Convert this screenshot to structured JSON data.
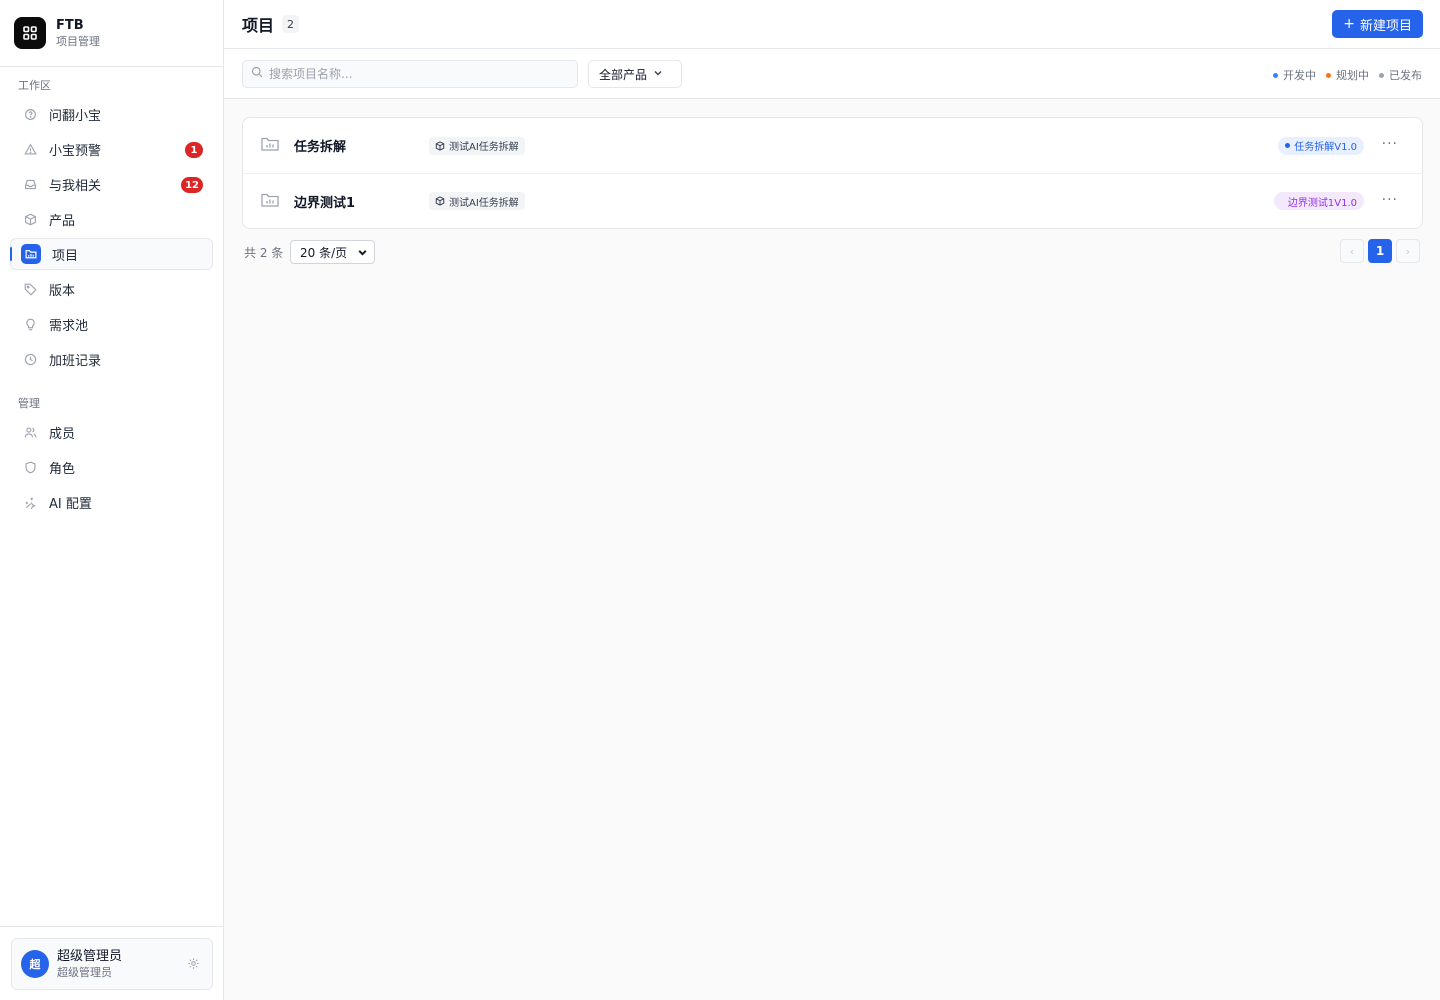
{
  "brand": {
    "title": "FTB",
    "subtitle": "项目管理",
    "icon": "grid-icon"
  },
  "sidebar": {
    "sections": [
      {
        "label": "工作区",
        "items": [
          {
            "label": "问翻小宝",
            "icon": "chat-bubble-icon"
          },
          {
            "label": "小宝预警",
            "icon": "warning-triangle-icon",
            "badge": "1"
          },
          {
            "label": "与我相关",
            "icon": "inbox-icon",
            "badge": "12"
          },
          {
            "label": "产品",
            "icon": "box-icon"
          },
          {
            "label": "项目",
            "icon": "folder-icon",
            "active": true
          },
          {
            "label": "版本",
            "icon": "tag-icon"
          },
          {
            "label": "需求池",
            "icon": "lightbulb-icon"
          },
          {
            "label": "加班记录",
            "icon": "clock-icon"
          }
        ]
      },
      {
        "label": "管理",
        "items": [
          {
            "label": "成员",
            "icon": "users-icon"
          },
          {
            "label": "角色",
            "icon": "shield-icon"
          },
          {
            "label": "AI 配置",
            "icon": "sparkles-icon"
          }
        ]
      }
    ]
  },
  "user": {
    "avatar_text": "超",
    "name": "超级管理员",
    "role": "超级管理员"
  },
  "header": {
    "title": "项目",
    "count": "2",
    "new_button": "新建项目"
  },
  "filters": {
    "search_placeholder": "搜索项目名称...",
    "product_select": "全部产品",
    "legend": [
      {
        "label": "开发中",
        "color": "#3b82f6"
      },
      {
        "label": "规划中",
        "color": "#f97316"
      },
      {
        "label": "已发布",
        "color": "#9ca3af"
      }
    ]
  },
  "projects": [
    {
      "name": "任务拆解",
      "product": "测试AI任务拆解",
      "version": "任务拆解V1.0",
      "version_color": "blue"
    },
    {
      "name": "边界测试1",
      "product": "测试AI任务拆解",
      "version": "边界测试1V1.0",
      "version_color": "purple"
    }
  ],
  "pagination": {
    "total": "共 2 条",
    "page_size": "20 条/页",
    "current_page": "1",
    "prev": "‹",
    "next": "›"
  }
}
